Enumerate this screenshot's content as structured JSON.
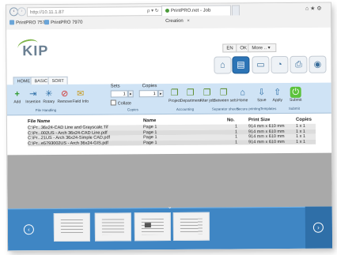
{
  "browser": {
    "address_text": "http://10.11.1.87",
    "address_icons": "ρ ▾ ↻",
    "tab_active_title": "PrintPRO.net - Job Creation",
    "tab_close": "×",
    "window_buttons": "⌂ ★ ⚙",
    "favorites": [
      "PrintPRO 7570",
      "PrintPRO 7970"
    ]
  },
  "header": {
    "logo_text": "KIP",
    "lang_en": "EN",
    "ok_label": "OK",
    "more_label": "More ..",
    "nav_icons": [
      "home-icon",
      "printer-icon",
      "job-list-icon",
      "settings-dial-icon",
      "print-queue-icon",
      "globe-icon"
    ]
  },
  "ribbon": {
    "tabs": [
      "HOME",
      "BASIC",
      "SORT"
    ],
    "active_tab": "HOME",
    "buttons_left": [
      {
        "label": "Add",
        "icon": "add-icon",
        "glyph": "+"
      },
      {
        "label": "Insertion",
        "icon": "insertion-icon",
        "glyph": "⇥"
      },
      {
        "label": "Rotary",
        "icon": "rotary-icon",
        "glyph": "✳"
      },
      {
        "label": "Remove",
        "icon": "remove-icon",
        "glyph": "⊘"
      },
      {
        "label": "Field Info",
        "icon": "field-info-icon",
        "glyph": "✉"
      }
    ],
    "sets_label": "Sets",
    "sets_value": "1",
    "copies_label": "Copies",
    "copies_value": "1",
    "collate_label": "Collate",
    "buttons_right": [
      {
        "label": "Project",
        "icon": "project-icon",
        "glyph": "❐"
      },
      {
        "label": "Department",
        "icon": "department-icon",
        "glyph": "❐"
      },
      {
        "label": "After job",
        "icon": "after-job-icon",
        "glyph": "❐"
      },
      {
        "label": "Between sets",
        "icon": "between-sets-icon",
        "glyph": "❐"
      },
      {
        "label": "Home",
        "icon": "secure-home-icon",
        "glyph": "⌂"
      },
      {
        "label": "Save",
        "icon": "save-icon",
        "glyph": "⇩"
      },
      {
        "label": "Apply",
        "icon": "apply-icon",
        "glyph": "⇧"
      },
      {
        "label": "Submit",
        "icon": "submit-icon",
        "glyph": "⏻"
      }
    ],
    "groups": [
      "File Handling",
      "Copies",
      "Accounting",
      "Separator sheets",
      "Secure printing",
      "Templates",
      "Submit"
    ]
  },
  "table": {
    "columns": [
      "File Name",
      "Name",
      "No.",
      "Print Size",
      "Copies"
    ],
    "rows": [
      [
        "C:\\Pr...36x24-CAD Line and Grayscale.Tif",
        "Page 1",
        "1",
        "914 mm x 610 mm",
        "1 x 1"
      ],
      [
        "C:\\Pr...002US - Arch 36x24-CAD Line.pdf",
        "Page 1",
        "1",
        "914 mm x 610 mm",
        "1 x 1"
      ],
      [
        "C:\\Pr...21US - Arch 36x24-Simple CAD.pdf",
        "Page 1",
        "1",
        "914 mm x 610 mm",
        "1 x 1"
      ],
      [
        "C:\\Pr...e5793002US - Arch 36x24-GIS.pdf",
        "Page 1",
        "1",
        "914 mm x 610 mm",
        "1 x 1"
      ]
    ]
  },
  "bottom": {
    "prev_glyph": "‹",
    "next_glyph": "›",
    "collapse_glyph": "⌄",
    "thumbnail_count": 4
  }
}
